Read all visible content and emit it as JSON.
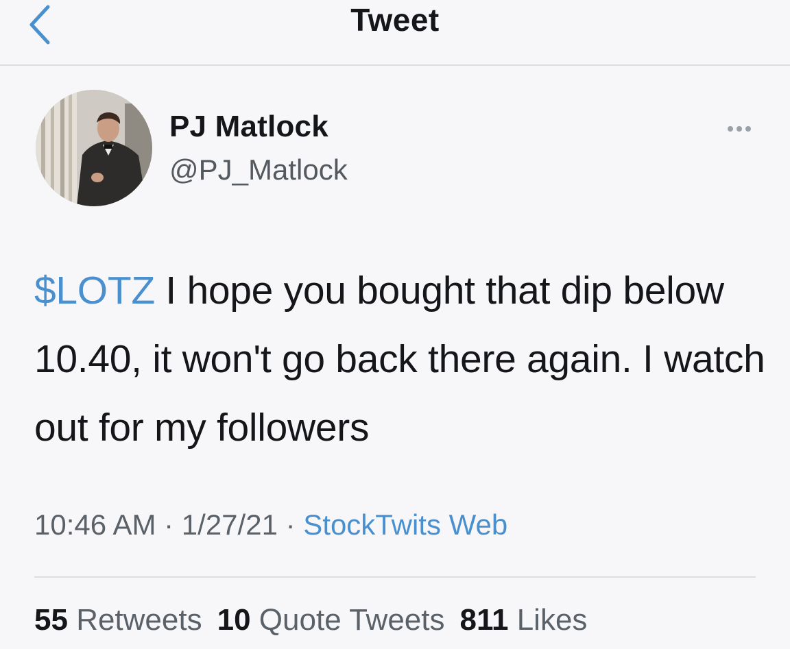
{
  "header": {
    "title": "Tweet",
    "back_icon": "chevron-left-icon"
  },
  "author": {
    "display_name": "PJ Matlock",
    "handle": "@PJ_Matlock"
  },
  "tweet": {
    "cashtag": "$LOTZ",
    "text": " I hope you bought that dip below 10.40, it won't go back there again. I watch out for my followers"
  },
  "meta": {
    "time": "10:46 AM",
    "separator": " · ",
    "date": "1/27/21",
    "source": "StockTwits Web"
  },
  "stats": {
    "retweets_count": "55",
    "retweets_label": "Retweets",
    "quotes_count": "10",
    "quotes_label": "Quote Tweets",
    "likes_count": "811",
    "likes_label": "Likes"
  },
  "colors": {
    "accent": "#4a90cf",
    "text": "#141619",
    "secondary": "#5b6168",
    "background": "#f7f7f9"
  }
}
